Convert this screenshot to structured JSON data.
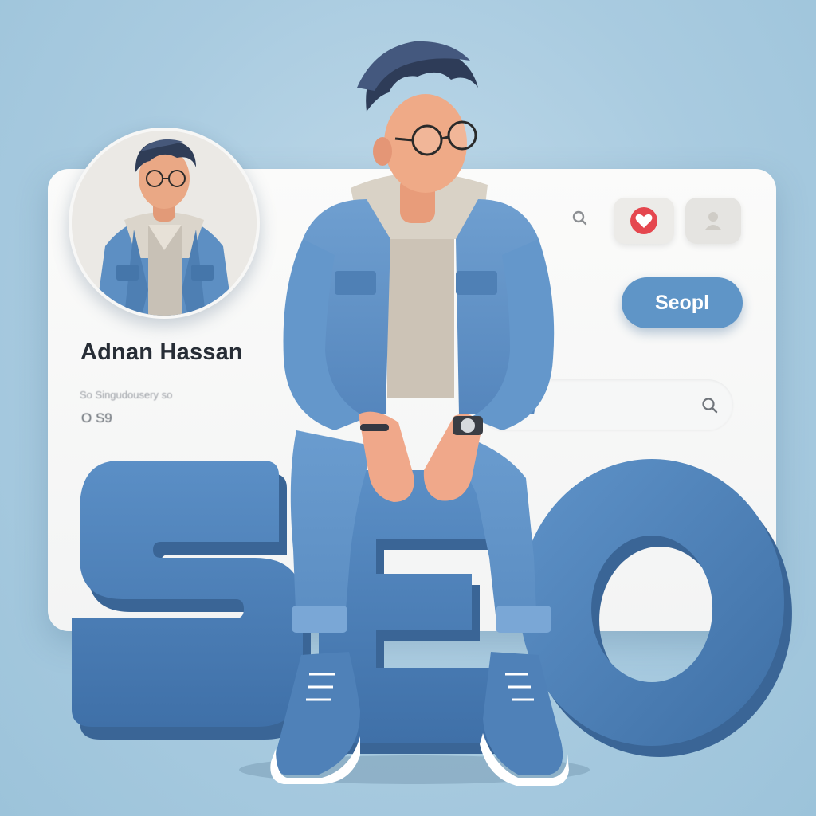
{
  "profile": {
    "name": "Adnan Hassan",
    "subtitle": "So Singudousery so",
    "meta": "O S9"
  },
  "actions": {
    "primary_button_label": "Seopl",
    "search_icon": "search-icon",
    "heart_icon": "heart-icon",
    "user_icon": "user-icon"
  },
  "big_text": "SEO",
  "colors": {
    "background": "#a9cbe0",
    "letters": "#4f81b8",
    "card": "#f7f7f6",
    "heart": "#e5474f",
    "button": "#5f95c7"
  }
}
